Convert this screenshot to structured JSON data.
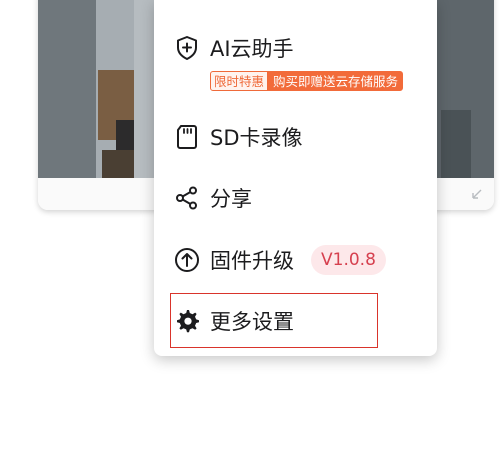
{
  "menu": {
    "items": [
      {
        "id": "ai-cloud",
        "label": "AI云助手",
        "icon": "shield-plus-icon"
      },
      {
        "id": "sd-record",
        "label": "SD卡录像",
        "icon": "sd-card-icon"
      },
      {
        "id": "share",
        "label": "分享",
        "icon": "share-icon"
      },
      {
        "id": "firmware",
        "label": "固件升级",
        "icon": "upload-circle-icon"
      },
      {
        "id": "more-settings",
        "label": "更多设置",
        "icon": "gear-icon"
      }
    ],
    "promo": {
      "tag": "限时特惠",
      "message": "购买即赠送云存储服务"
    },
    "firmware_version": "V1.0.8"
  },
  "colors": {
    "promo_accent": "#f26b3a",
    "version_text": "#d6404f",
    "version_bg": "#fde8ea",
    "highlight_border": "#d9342b"
  }
}
